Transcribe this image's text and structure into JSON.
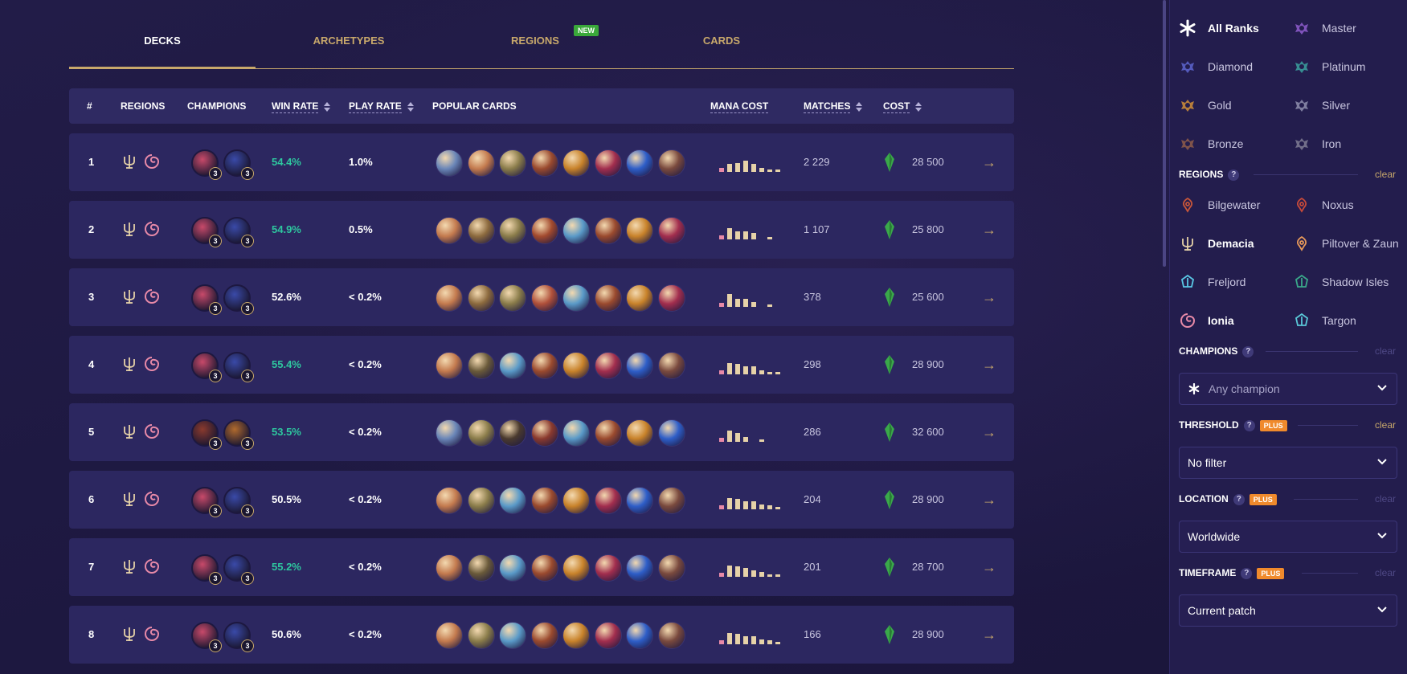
{
  "tabs": [
    {
      "label": "DECKS",
      "active": true
    },
    {
      "label": "ARCHETYPES",
      "badge": "NEW"
    },
    {
      "label": "REGIONS"
    },
    {
      "label": "CARDS"
    }
  ],
  "table_headers": {
    "rank": "#",
    "regions": "REGIONS",
    "champions": "CHAMPIONS",
    "win_rate": "WIN RATE",
    "play_rate": "PLAY RATE",
    "popular_cards": "POPULAR CARDS",
    "mana_cost": "MANA COST",
    "matches": "MATCHES",
    "cost": "COST"
  },
  "decks": [
    {
      "rank": "1",
      "win_rate": "54.4%",
      "wr_good": true,
      "play_rate": "1.0%",
      "matches": "2 229",
      "cost": "28 500",
      "champ_copies": [
        "3",
        "3"
      ],
      "mana": [
        0.3,
        0.6,
        0.7,
        0.9,
        0.6,
        0.3,
        0.2,
        0.2
      ],
      "cards": [
        "#6a86b8",
        "#c37a4e",
        "#8a7c4a",
        "#9a4a2e",
        "#c8822a",
        "#a22e4e",
        "#2e5ec8",
        "#7a4a3e"
      ]
    },
    {
      "rank": "2",
      "win_rate": "54.9%",
      "wr_good": true,
      "play_rate": "0.5%",
      "matches": "1 107",
      "cost": "25 800",
      "champ_copies": [
        "3",
        "3"
      ],
      "mana": [
        0.3,
        0.9,
        0.6,
        0.6,
        0.5,
        0,
        0.2,
        0
      ],
      "cards": [
        "#c37a4e",
        "#8c6a3e",
        "#8a7c4a",
        "#a24a2e",
        "#5a9ac8",
        "#9a4a2e",
        "#c8822a",
        "#a22e4e"
      ]
    },
    {
      "rank": "3",
      "win_rate": "52.6%",
      "wr_good": false,
      "play_rate": "< 0.2%",
      "matches": "378",
      "cost": "25 600",
      "champ_copies": [
        "3",
        "3"
      ],
      "mana": [
        0.3,
        1.0,
        0.6,
        0.6,
        0.4,
        0,
        0.2,
        0
      ],
      "cards": [
        "#c37a4e",
        "#8c6a3e",
        "#8a7c4a",
        "#b0503a",
        "#5a9ac8",
        "#9a4a2e",
        "#c8822a",
        "#a22e4e"
      ]
    },
    {
      "rank": "4",
      "win_rate": "55.4%",
      "wr_good": true,
      "play_rate": "< 0.2%",
      "matches": "298",
      "cost": "28 900",
      "champ_copies": [
        "3",
        "3"
      ],
      "mana": [
        0.3,
        0.9,
        0.8,
        0.6,
        0.6,
        0.3,
        0.2,
        0.2
      ],
      "cards": [
        "#c37a4e",
        "#6a5a3a",
        "#5a9ac8",
        "#9a4a2e",
        "#c8822a",
        "#a22e4e",
        "#2e5ec8",
        "#7a4a3e"
      ]
    },
    {
      "rank": "5",
      "win_rate": "53.5%",
      "wr_good": true,
      "play_rate": "< 0.2%",
      "matches": "286",
      "cost": "32 600",
      "champ_copies": [
        "3",
        "3"
      ],
      "mana": [
        0.3,
        0.9,
        0.7,
        0.4,
        0,
        0.2,
        0,
        0
      ],
      "cards": [
        "#6a86b8",
        "#8a7c4a",
        "#4a3a2e",
        "#8a3a2e",
        "#5a9ac8",
        "#9a4a2e",
        "#c8822a",
        "#2e5ec8"
      ]
    },
    {
      "rank": "6",
      "win_rate": "50.5%",
      "wr_good": false,
      "play_rate": "< 0.2%",
      "matches": "204",
      "cost": "28 900",
      "champ_copies": [
        "3",
        "3"
      ],
      "mana": [
        0.3,
        0.9,
        0.8,
        0.6,
        0.6,
        0.4,
        0.3,
        0.2
      ],
      "cards": [
        "#c37a4e",
        "#8a7c4a",
        "#5a9ac8",
        "#9a4a2e",
        "#c8822a",
        "#a22e4e",
        "#2e5ec8",
        "#7a4a3e"
      ]
    },
    {
      "rank": "7",
      "win_rate": "55.2%",
      "wr_good": true,
      "play_rate": "< 0.2%",
      "matches": "201",
      "cost": "28 700",
      "champ_copies": [
        "3",
        "3"
      ],
      "mana": [
        0.3,
        0.9,
        0.8,
        0.7,
        0.5,
        0.4,
        0.2,
        0.2
      ],
      "cards": [
        "#c37a4e",
        "#6a5a3a",
        "#5a9ac8",
        "#9a4a2e",
        "#c8822a",
        "#a22e4e",
        "#2e5ec8",
        "#7a4a3e"
      ]
    },
    {
      "rank": "8",
      "win_rate": "50.6%",
      "wr_good": false,
      "play_rate": "< 0.2%",
      "matches": "166",
      "cost": "28 900",
      "champ_copies": [
        "3",
        "3"
      ],
      "mana": [
        0.3,
        0.9,
        0.8,
        0.6,
        0.6,
        0.4,
        0.3,
        0.2
      ],
      "cards": [
        "#c37a4e",
        "#8a7c4a",
        "#5a9ac8",
        "#9a4a2e",
        "#c8822a",
        "#a22e4e",
        "#2e5ec8",
        "#7a4a3e"
      ]
    }
  ],
  "sidebar": {
    "ranks": [
      {
        "label": "All Ranks",
        "selected": true,
        "icon": "asterisk-icon",
        "color": "#ffffff"
      },
      {
        "label": "Master",
        "icon": "rank-master-icon",
        "color": "#8a5ac8"
      },
      {
        "label": "Diamond",
        "icon": "rank-diamond-icon",
        "color": "#5a62c8"
      },
      {
        "label": "Platinum",
        "icon": "rank-platinum-icon",
        "color": "#3a9a9a"
      },
      {
        "label": "Gold",
        "icon": "rank-gold-icon",
        "color": "#c88a3a"
      },
      {
        "label": "Silver",
        "icon": "rank-silver-icon",
        "color": "#8a8aa8"
      },
      {
        "label": "Bronze",
        "icon": "rank-bronze-icon",
        "color": "#8a5a4a"
      },
      {
        "label": "Iron",
        "icon": "rank-iron-icon",
        "color": "#7a7890"
      }
    ],
    "regions_title": "REGIONS",
    "regions_clear": "clear",
    "regions": [
      {
        "label": "Bilgewater",
        "icon": "bilgewater-icon",
        "color": "#c8563a"
      },
      {
        "label": "Noxus",
        "icon": "noxus-icon",
        "color": "#c84a3a"
      },
      {
        "label": "Demacia",
        "selected": true,
        "icon": "demacia-icon",
        "color": "#e6d2a8"
      },
      {
        "label": "Piltover & Zaun",
        "icon": "piltover-icon",
        "color": "#e89a5a"
      },
      {
        "label": "Freljord",
        "icon": "freljord-icon",
        "color": "#5ac8e6"
      },
      {
        "label": "Shadow Isles",
        "icon": "shadow-isles-icon",
        "color": "#3aa88a"
      },
      {
        "label": "Ionia",
        "selected": true,
        "icon": "ionia-icon",
        "color": "#e88aa8"
      },
      {
        "label": "Targon",
        "icon": "targon-icon",
        "color": "#5ac8d8"
      }
    ],
    "champions_title": "CHAMPIONS",
    "champions_clear": "clear",
    "champion_placeholder": "Any champion",
    "threshold_title": "THRESHOLD",
    "threshold_badge": "PLUS",
    "threshold_clear": "clear",
    "threshold_value": "No filter",
    "location_title": "LOCATION",
    "location_badge": "PLUS",
    "location_clear": "clear",
    "location_value": "Worldwide",
    "timeframe_title": "TIMEFRAME",
    "timeframe_badge": "PLUS",
    "timeframe_clear": "clear",
    "timeframe_value": "Current patch"
  },
  "colors": {
    "accent_gold": "#c8a86b",
    "win_green": "#2ec79f",
    "plus_orange": "#f08a2c",
    "new_green": "#3aa83a"
  }
}
